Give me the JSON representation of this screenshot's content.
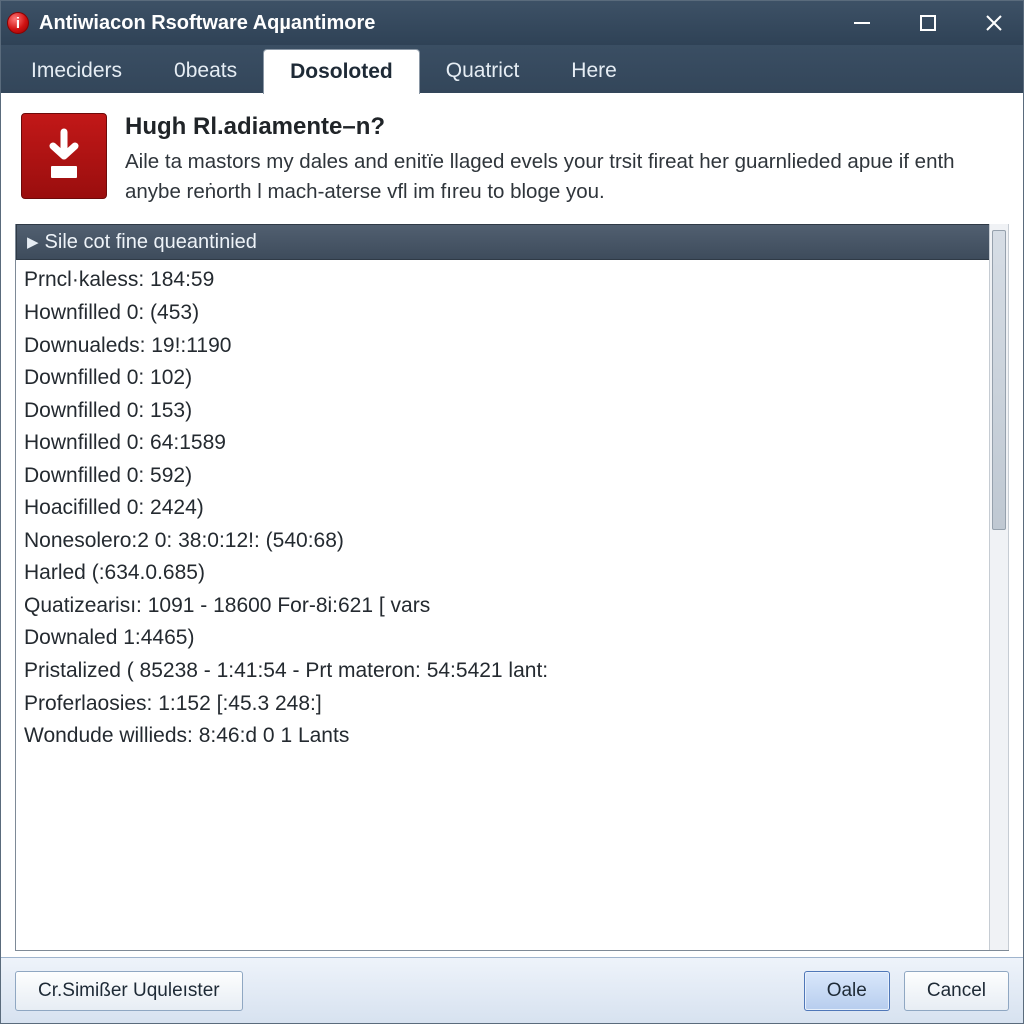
{
  "window": {
    "title": "Antiwiacon Rsoftware Aqµantimore"
  },
  "tabs": [
    {
      "label": "Imeciders"
    },
    {
      "label": "0beats"
    },
    {
      "label": "Dosoloted"
    },
    {
      "label": "Quatrict"
    },
    {
      "label": "Here"
    }
  ],
  "active_tab_index": 2,
  "banner": {
    "heading": "Hugh Rl.adiamente–n?",
    "desc": "Aile ta mastors my dales and enitïe llaged evels your trsit fireat her guarnlieded apue if enth anybe reṅorth l mach‑aterse vfl im fıreu to bloge you."
  },
  "log": {
    "header": "Sile cot fine queantinied",
    "lines": [
      "Prncl·kaless: 184:59",
      "Hownfilled 0: (453)",
      "Downualeds: 19!:1190",
      "Downfilled 0: 102)",
      "Downfilled 0: 153)",
      "Hownfilled 0: 64:1589",
      "Downfilled 0: 592)",
      "Hoacifilled 0: 2424)",
      "Nonesolero:2 0: 38:0:12!: (540:68)",
      "Harled (:634.0.685)",
      "Quatizearisı: 1091 - 18600 For-8i:621 [ vars",
      "Downaled 1:4465)",
      "Pristalized ( 85238 - 1:41:54 - Prt materon: 54:5421 lant:",
      "Proferlaosies: 1:152 [:45.3 248:]",
      "Wondude willieds: 8:46:d 0 1 Lants"
    ]
  },
  "footer": {
    "left_button": "Cr.Simißer Uquleıster",
    "primary_button": "Oale",
    "cancel_button": "Cancel"
  }
}
